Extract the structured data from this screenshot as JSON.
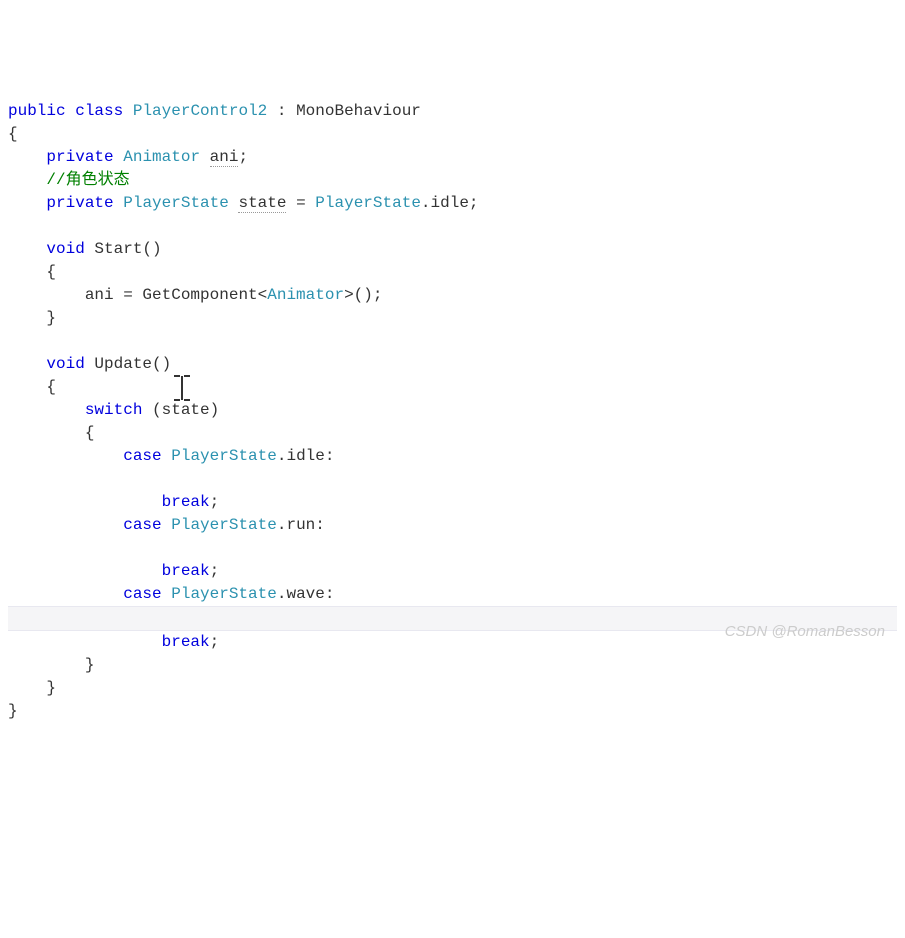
{
  "code": {
    "line1_kw1": "public",
    "line1_kw2": "class",
    "line1_type": "PlayerControl2",
    "line1_rest": " : MonoBehaviour",
    "line2": "{",
    "line3_kw": "private",
    "line3_type": "Animator",
    "line3_var": "ani",
    "line3_semi": ";",
    "line4_comment": "//角色状态",
    "line5_kw": "private",
    "line5_type1": "PlayerState",
    "line5_var": "state",
    "line5_eq": " = ",
    "line5_type2": "PlayerState",
    "line5_rest": ".idle;",
    "line7_kw": "void",
    "line7_name": " Start()",
    "line8": "{",
    "line9_a": "ani = GetComponent<",
    "line9_type": "Animator",
    "line9_b": ">();",
    "line10": "}",
    "line12_kw": "void",
    "line12_name": " Update()",
    "line13": "{",
    "line14_kw": "switch",
    "line14_rest": " (state)",
    "line15": "{",
    "line16_kw": "case",
    "line16_type": "PlayerState",
    "line16_rest": ".idle:",
    "line18_kw": "break",
    "line18_semi": ";",
    "line19_kw": "case",
    "line19_type": "PlayerState",
    "line19_rest": ".run:",
    "line21_kw": "break",
    "line21_semi": ";",
    "line22_kw": "case",
    "line22_type": "PlayerState",
    "line22_rest": ".wave:",
    "line24_kw": "break",
    "line24_semi": ";",
    "line25": "}",
    "line26": "}",
    "line27": "}",
    "watermark": "CSDN @RomanBesson"
  }
}
